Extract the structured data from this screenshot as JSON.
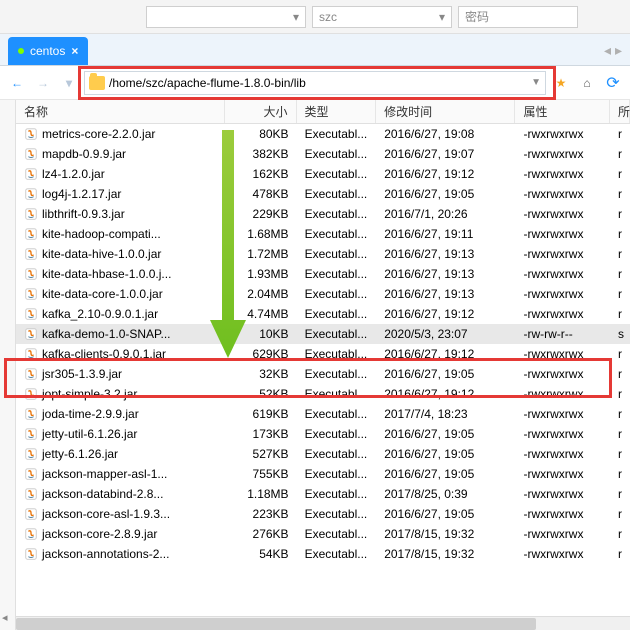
{
  "topbar": {
    "user_placeholder": "szc",
    "pwd_placeholder": "密码"
  },
  "tab": {
    "label": "centos",
    "close": "×"
  },
  "nav": {
    "back": "←",
    "fwd": "→",
    "sep": "▾"
  },
  "address": {
    "path": "/home/szc/apache-flume-1.8.0-bin/lib"
  },
  "toolbtns": {
    "star": "★",
    "home": "⌂",
    "refresh": "⟳"
  },
  "columns": {
    "name": "名称",
    "size": "大小",
    "type": "类型",
    "date": "修改时间",
    "attr": "属性",
    "last": "所"
  },
  "files": [
    {
      "name": "metrics-core-2.2.0.jar",
      "size": "80KB",
      "type": "Executabl...",
      "date": "2016/6/27, 19:08",
      "attr": "-rwxrwxrwx",
      "last": "r"
    },
    {
      "name": "mapdb-0.9.9.jar",
      "size": "382KB",
      "type": "Executabl...",
      "date": "2016/6/27, 19:07",
      "attr": "-rwxrwxrwx",
      "last": "r"
    },
    {
      "name": "lz4-1.2.0.jar",
      "size": "162KB",
      "type": "Executabl...",
      "date": "2016/6/27, 19:12",
      "attr": "-rwxrwxrwx",
      "last": "r"
    },
    {
      "name": "log4j-1.2.17.jar",
      "size": "478KB",
      "type": "Executabl...",
      "date": "2016/6/27, 19:05",
      "attr": "-rwxrwxrwx",
      "last": "r"
    },
    {
      "name": "libthrift-0.9.3.jar",
      "size": "229KB",
      "type": "Executabl...",
      "date": "2016/7/1, 20:26",
      "attr": "-rwxrwxrwx",
      "last": "r"
    },
    {
      "name": "kite-hadoop-compati...",
      "size": "1.68MB",
      "type": "Executabl...",
      "date": "2016/6/27, 19:11",
      "attr": "-rwxrwxrwx",
      "last": "r"
    },
    {
      "name": "kite-data-hive-1.0.0.jar",
      "size": "1.72MB",
      "type": "Executabl...",
      "date": "2016/6/27, 19:13",
      "attr": "-rwxrwxrwx",
      "last": "r"
    },
    {
      "name": "kite-data-hbase-1.0.0.j...",
      "size": "1.93MB",
      "type": "Executabl...",
      "date": "2016/6/27, 19:13",
      "attr": "-rwxrwxrwx",
      "last": "r"
    },
    {
      "name": "kite-data-core-1.0.0.jar",
      "size": "2.04MB",
      "type": "Executabl...",
      "date": "2016/6/27, 19:13",
      "attr": "-rwxrwxrwx",
      "last": "r"
    },
    {
      "name": "kafka_2.10-0.9.0.1.jar",
      "size": "4.74MB",
      "type": "Executabl...",
      "date": "2016/6/27, 19:12",
      "attr": "-rwxrwxrwx",
      "last": "r"
    },
    {
      "name": "kafka-demo-1.0-SNAP...",
      "size": "10KB",
      "type": "Executabl...",
      "date": "2020/5/3, 23:07",
      "attr": "-rw-rw-r--",
      "last": "s",
      "selected": true
    },
    {
      "name": "kafka-clients-0.9.0.1.jar",
      "size": "629KB",
      "type": "Executabl...",
      "date": "2016/6/27, 19:12",
      "attr": "-rwxrwxrwx",
      "last": "r"
    },
    {
      "name": "jsr305-1.3.9.jar",
      "size": "32KB",
      "type": "Executabl...",
      "date": "2016/6/27, 19:05",
      "attr": "-rwxrwxrwx",
      "last": "r"
    },
    {
      "name": "jopt-simple-3.2.jar",
      "size": "52KB",
      "type": "Executabl...",
      "date": "2016/6/27, 19:12",
      "attr": "-rwxrwxrwx",
      "last": "r"
    },
    {
      "name": "joda-time-2.9.9.jar",
      "size": "619KB",
      "type": "Executabl...",
      "date": "2017/7/4, 18:23",
      "attr": "-rwxrwxrwx",
      "last": "r"
    },
    {
      "name": "jetty-util-6.1.26.jar",
      "size": "173KB",
      "type": "Executabl...",
      "date": "2016/6/27, 19:05",
      "attr": "-rwxrwxrwx",
      "last": "r"
    },
    {
      "name": "jetty-6.1.26.jar",
      "size": "527KB",
      "type": "Executabl...",
      "date": "2016/6/27, 19:05",
      "attr": "-rwxrwxrwx",
      "last": "r"
    },
    {
      "name": "jackson-mapper-asl-1...",
      "size": "755KB",
      "type": "Executabl...",
      "date": "2016/6/27, 19:05",
      "attr": "-rwxrwxrwx",
      "last": "r"
    },
    {
      "name": "jackson-databind-2.8...",
      "size": "1.18MB",
      "type": "Executabl...",
      "date": "2017/8/25, 0:39",
      "attr": "-rwxrwxrwx",
      "last": "r"
    },
    {
      "name": "jackson-core-asl-1.9.3...",
      "size": "223KB",
      "type": "Executabl...",
      "date": "2016/6/27, 19:05",
      "attr": "-rwxrwxrwx",
      "last": "r"
    },
    {
      "name": "jackson-core-2.8.9.jar",
      "size": "276KB",
      "type": "Executabl...",
      "date": "2017/8/15, 19:32",
      "attr": "-rwxrwxrwx",
      "last": "r"
    },
    {
      "name": "jackson-annotations-2...",
      "size": "54KB",
      "type": "Executabl...",
      "date": "2017/8/15, 19:32",
      "attr": "-rwxrwxrwx",
      "last": "r"
    }
  ]
}
